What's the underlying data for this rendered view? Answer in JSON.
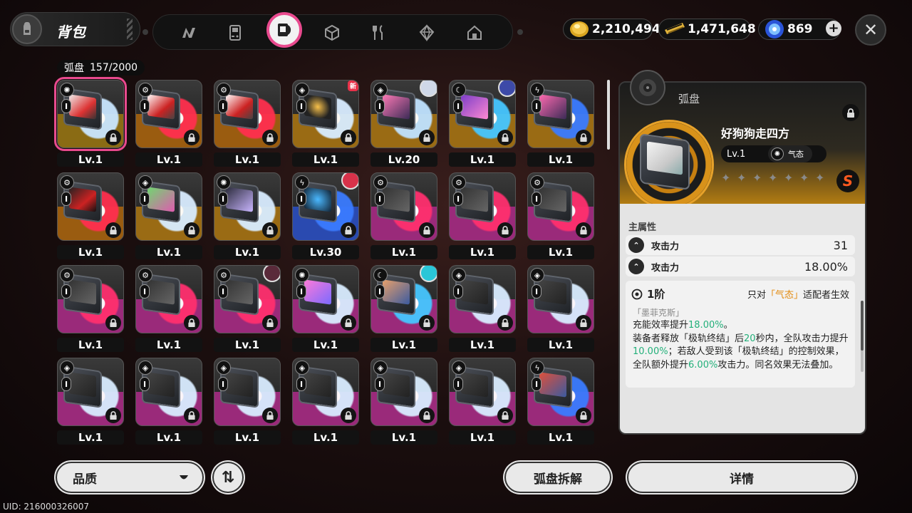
{
  "header": {
    "title": "背包",
    "tabs": [
      {
        "name": "agent-tab",
        "icon": "n-logo-icon"
      },
      {
        "name": "device-tab",
        "icon": "gameboy-icon"
      },
      {
        "name": "disc-tab",
        "icon": "disc-case-icon",
        "active": true
      },
      {
        "name": "box-tab",
        "icon": "cube-icon"
      },
      {
        "name": "food-tab",
        "icon": "fork-knife-icon"
      },
      {
        "name": "material-tab",
        "icon": "crystal-icon"
      },
      {
        "name": "home-tab",
        "icon": "house-icon"
      }
    ],
    "currencies": [
      {
        "name": "dennies",
        "value": "2,210,494"
      },
      {
        "name": "ticket",
        "value": "1,471,648"
      },
      {
        "name": "polychrome",
        "value": "869"
      }
    ],
    "close": "✕"
  },
  "inventory": {
    "label": "弧盘",
    "count": "157/2000",
    "rows": [
      [
        {
          "lv": "Lv.1",
          "tone": "#8a6b14",
          "ring": "#c9e6ff",
          "art": "linear-gradient(135deg,#eee,#d33 60%,#333)",
          "attr": "✺",
          "selected": true
        },
        {
          "lv": "Lv.1",
          "tone": "#9a5c10",
          "ring": "#ff2f4e",
          "art": "linear-gradient(135deg,#fff,#c22 60%,#444)",
          "attr": "⚙"
        },
        {
          "lv": "Lv.1",
          "tone": "#9a5c10",
          "ring": "#ff2f4e",
          "art": "linear-gradient(135deg,#fff,#c22 60%,#444)",
          "attr": "⚙"
        },
        {
          "lv": "Lv.1",
          "tone": "#9a6b14",
          "ring": "#d8ecff",
          "art": "radial-gradient(circle,#f7c04a,#222 70%)",
          "attr": "◈",
          "new": "新"
        },
        {
          "lv": "Lv.20",
          "tone": "#9a6b14",
          "ring": "#bfe2ff",
          "art": "linear-gradient(135deg,#ff7ab6,#3a2a55)",
          "attr": "◈",
          "avatar": "#cfd8e8"
        },
        {
          "lv": "Lv.1",
          "tone": "#9a6b14",
          "ring": "#46c6ff",
          "art": "linear-gradient(135deg,#7a3cc8,#ff8ad2)",
          "attr": "☾",
          "avatar": "#3d4aa8"
        },
        {
          "lv": "Lv.1",
          "tone": "#9a6b14",
          "ring": "#3a7bff",
          "art": "linear-gradient(135deg,#ff6ab0,#3a2a55)",
          "attr": "ϟ"
        }
      ],
      [
        {
          "lv": "Lv.1",
          "tone": "#9a5c10",
          "ring": "#ff2f4e",
          "art": "linear-gradient(135deg,#222,#c22 60%,#111)",
          "attr": "⚙"
        },
        {
          "lv": "Lv.1",
          "tone": "#9a6b14",
          "ring": "#d8ecff",
          "art": "linear-gradient(135deg,#6fd86f,#e05ab0)",
          "attr": "◈"
        },
        {
          "lv": "Lv.1",
          "tone": "#9a6b14",
          "ring": "#d8ecff",
          "art": "linear-gradient(135deg,#2a2a3a,#c9b6ff)",
          "attr": "✺"
        },
        {
          "lv": "Lv.30",
          "tone": "#2a4ab0",
          "ring": "#3a7bff",
          "art": "radial-gradient(circle,#4ab8ff,#123)",
          "attr": "ϟ",
          "avatar": "#d8324a"
        },
        {
          "lv": "Lv.1",
          "tone": "#9a2a7a",
          "ring": "#ff2f6e",
          "art": "linear-gradient(135deg,#333,#666)",
          "attr": "⚙"
        },
        {
          "lv": "Lv.1",
          "tone": "#9a2a7a",
          "ring": "#ff2f6e",
          "art": "linear-gradient(135deg,#333,#666)",
          "attr": "⚙"
        },
        {
          "lv": "Lv.1",
          "tone": "#9a2a7a",
          "ring": "#ff2f6e",
          "art": "linear-gradient(135deg,#333,#666)",
          "attr": "⚙"
        }
      ],
      [
        {
          "lv": "Lv.1",
          "tone": "#9a2a7a",
          "ring": "#ff2f6e",
          "art": "linear-gradient(135deg,#333,#666)",
          "attr": "⚙"
        },
        {
          "lv": "Lv.1",
          "tone": "#9a2a7a",
          "ring": "#ff2f6e",
          "art": "linear-gradient(135deg,#333,#666)",
          "attr": "⚙"
        },
        {
          "lv": "Lv.1",
          "tone": "#9a2a7a",
          "ring": "#ff2f6e",
          "art": "linear-gradient(135deg,#333,#666)",
          "attr": "⚙",
          "avatar": "#5a2a3a"
        },
        {
          "lv": "Lv.1",
          "tone": "#9a2a7a",
          "ring": "#d8ecff",
          "art": "linear-gradient(135deg,#ff7ad8,#7a6aff)",
          "attr": "✺"
        },
        {
          "lv": "Lv.1",
          "tone": "#9a2a7a",
          "ring": "#46c6ff",
          "art": "linear-gradient(135deg,#e9a06a,#3a5aa0)",
          "attr": "☾",
          "avatar": "#2ac6d8"
        },
        {
          "lv": "Lv.1",
          "tone": "#9a2a7a",
          "ring": "#d8ecff",
          "art": "linear-gradient(135deg,#444,#222)",
          "attr": "◈"
        },
        {
          "lv": "Lv.1",
          "tone": "#9a2a7a",
          "ring": "#d8ecff",
          "art": "linear-gradient(135deg,#444,#222)",
          "attr": "◈"
        }
      ],
      [
        {
          "lv": "Lv.1",
          "tone": "#9a2a7a",
          "ring": "#d8ecff",
          "art": "linear-gradient(135deg,#444,#222)",
          "attr": "◈"
        },
        {
          "lv": "Lv.1",
          "tone": "#9a2a7a",
          "ring": "#d8ecff",
          "art": "linear-gradient(135deg,#444,#222)",
          "attr": "◈"
        },
        {
          "lv": "Lv.1",
          "tone": "#9a2a7a",
          "ring": "#d8ecff",
          "art": "linear-gradient(135deg,#444,#222)",
          "attr": "◈"
        },
        {
          "lv": "Lv.1",
          "tone": "#9a2a7a",
          "ring": "#d8ecff",
          "art": "linear-gradient(135deg,#444,#222)",
          "attr": "◈"
        },
        {
          "lv": "Lv.1",
          "tone": "#9a2a7a",
          "ring": "#d8ecff",
          "art": "linear-gradient(135deg,#444,#222)",
          "attr": "◈"
        },
        {
          "lv": "Lv.1",
          "tone": "#9a2a7a",
          "ring": "#d8ecff",
          "art": "linear-gradient(135deg,#444,#222)",
          "attr": "◈"
        },
        {
          "lv": "Lv.1",
          "tone": "#9a2a7a",
          "ring": "#3a7bff",
          "art": "linear-gradient(135deg,#e0503a,#3a5aa0)",
          "attr": "ϟ"
        }
      ]
    ]
  },
  "controls": {
    "quality": "品质",
    "sort": "⇅",
    "dismantle": "弧盘拆解",
    "details": "详情"
  },
  "uid": "UID: 216000326007",
  "detail": {
    "category": "弧盘",
    "name": "好狗狗走四方",
    "level": "Lv.1",
    "attribute": "气态",
    "attribute_icon": "✺",
    "stars": [
      "✦",
      "✦",
      "✦",
      "✦",
      "✦",
      "✦",
      "✦"
    ],
    "rank": "S",
    "main_stat_title": "主属性",
    "stats": [
      {
        "name": "攻击力",
        "value": "31"
      },
      {
        "name": "攻击力",
        "value": "18.00%"
      }
    ],
    "tier": "1阶",
    "only_pre": "只对",
    "only_attr": "「气态」",
    "only_post": "适配者生效",
    "set_name": "「墨菲克斯」",
    "desc": [
      {
        "t": "充能效率提升"
      },
      {
        "t": "18.00%",
        "g": true
      },
      {
        "t": "。"
      },
      {
        "br": true
      },
      {
        "t": "装备者释放「极轨终结」后"
      },
      {
        "t": "20",
        "g": true
      },
      {
        "t": "秒内，全队攻击力提升"
      },
      {
        "t": "10.00%",
        "g": true
      },
      {
        "t": "；若敌人受到该「极轨终结」的控制效果，全队额外提升"
      },
      {
        "t": "6.00%",
        "g": true
      },
      {
        "t": "攻击力。同名效果无法叠加。"
      }
    ]
  },
  "colors": {
    "accent": "#e84a8e",
    "green_value": "#23b07a",
    "orange_highlight": "#e38a0f"
  }
}
